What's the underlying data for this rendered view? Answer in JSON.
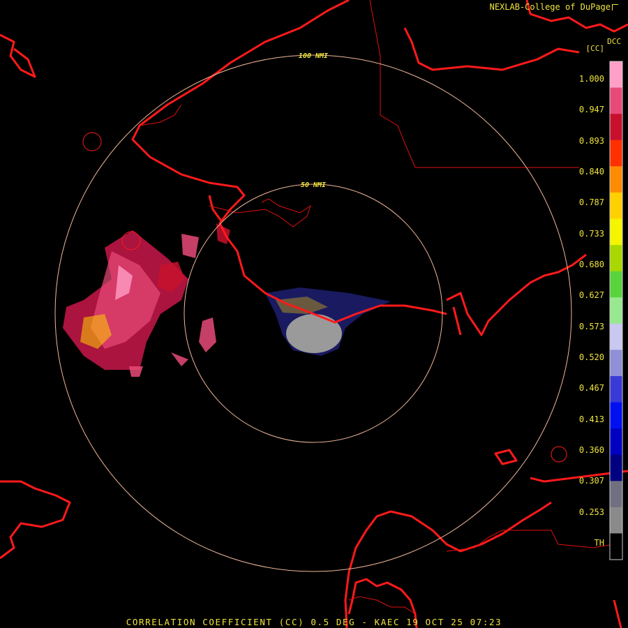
{
  "header": {
    "credit": "NEXLAB-College of DuPage"
  },
  "legend": {
    "product": "DCC",
    "unit": "[CC]",
    "labels": [
      "1.000",
      "0.947",
      "0.893",
      "0.840",
      "0.787",
      "0.733",
      "0.680",
      "0.627",
      "0.573",
      "0.520",
      "0.467",
      "0.413",
      "0.360",
      "0.307",
      "0.253",
      "TH"
    ],
    "colors": [
      "#ff9ec7",
      "#e84a78",
      "#c8102e",
      "#ff3000",
      "#ff8c00",
      "#ffd000",
      "#f5f500",
      "#a8d800",
      "#5ad43c",
      "#98e890",
      "#c8c8f0",
      "#9090d8",
      "#3a3ad8",
      "#0010f0",
      "#0000c0",
      "#000080",
      "#707080",
      "#8a8a8a",
      "#000000"
    ]
  },
  "range_rings": {
    "inner_label": "50 NMI",
    "outer_label": "100 NMI"
  },
  "footer": {
    "caption": "CORRELATION COEFFICIENT (CC) 0.5 DEG - KAEC 19 OCT 25 07:23"
  },
  "colors": {
    "coastline": "#ff1a1a",
    "ring": "#f0b89a",
    "text": "#f0e43c",
    "background": "#000000"
  }
}
